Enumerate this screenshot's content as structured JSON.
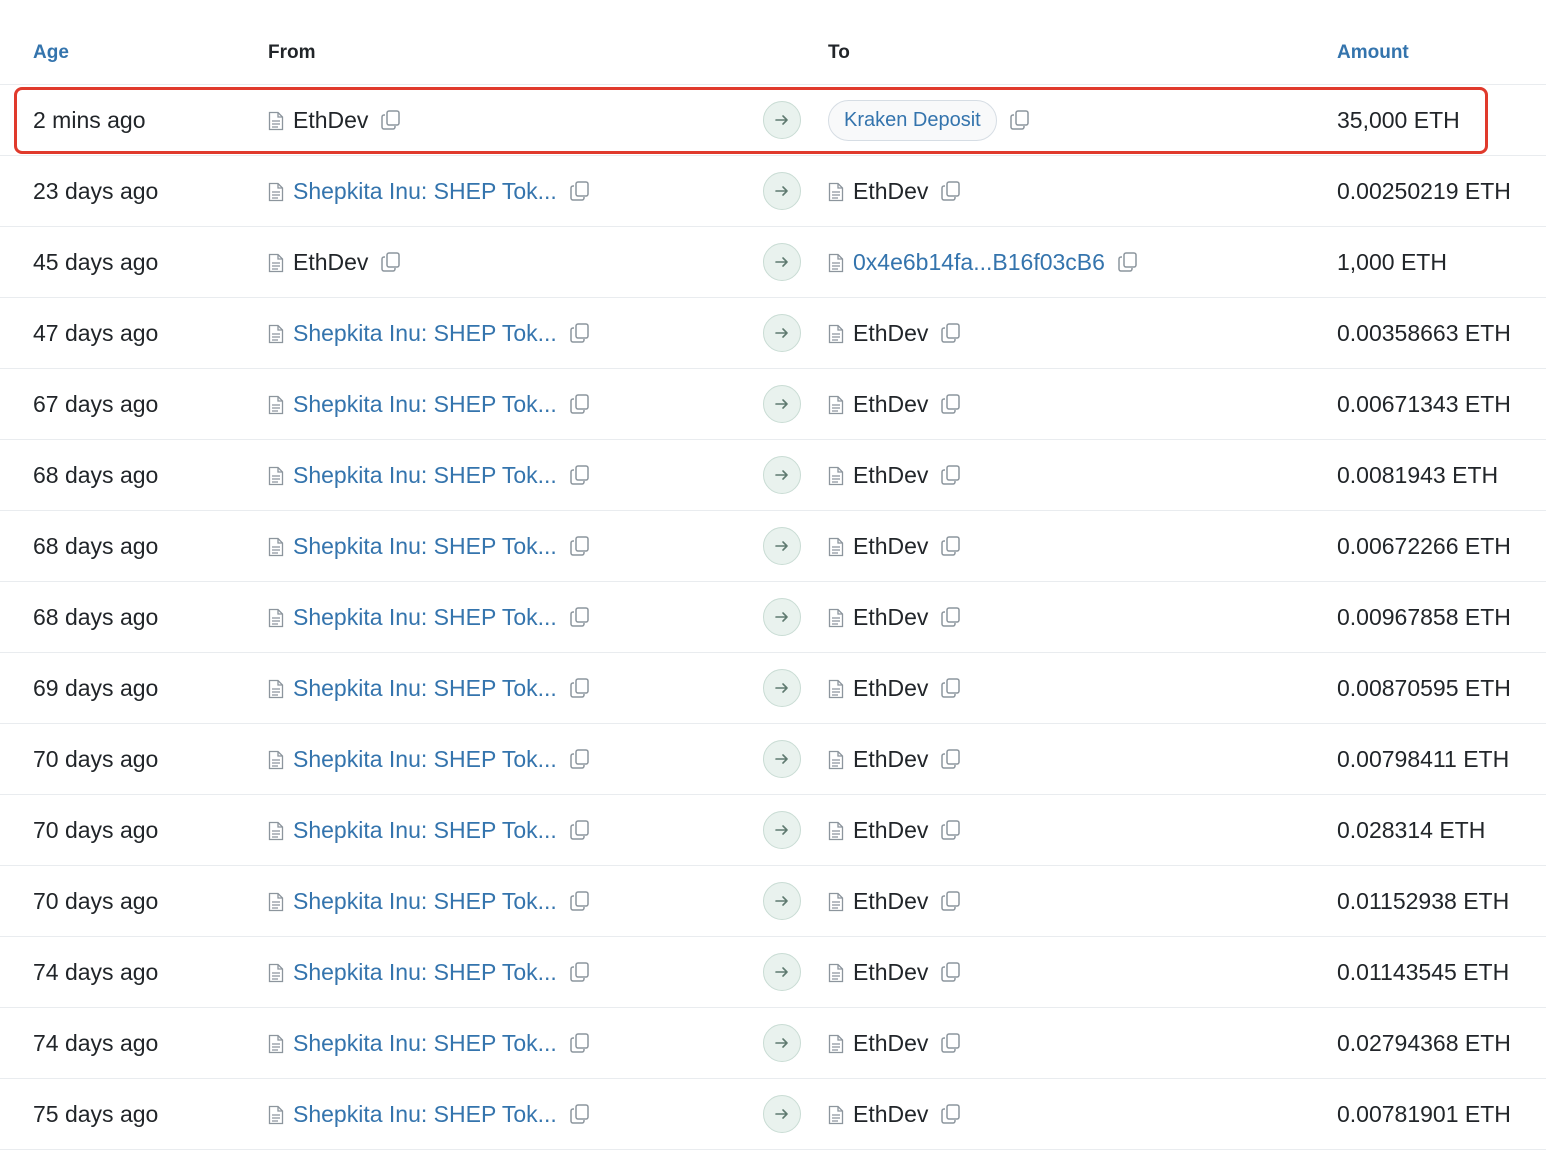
{
  "headers": {
    "age": "Age",
    "from": "From",
    "to": "To",
    "amount": "Amount"
  },
  "highlight_color": "#e03a2c",
  "link_color": "#3474ad",
  "icons": {
    "address": "document-icon",
    "copy": "copy-icon",
    "direction": "arrow-right-icon"
  },
  "rows": [
    {
      "age": "2 mins ago",
      "from": {
        "label": "EthDev",
        "link": false
      },
      "to": {
        "label": "Kraken Deposit",
        "tag": true
      },
      "amount": "35,000 ETH"
    },
    {
      "age": "23 days ago",
      "from": {
        "label": "Shepkita Inu: SHEP Tok...",
        "link": true
      },
      "to": {
        "label": "EthDev",
        "link": false
      },
      "amount": "0.00250219 ETH"
    },
    {
      "age": "45 days ago",
      "from": {
        "label": "EthDev",
        "link": false
      },
      "to": {
        "label": "0x4e6b14fa...B16f03cB6",
        "link": true
      },
      "amount": "1,000 ETH"
    },
    {
      "age": "47 days ago",
      "from": {
        "label": "Shepkita Inu: SHEP Tok...",
        "link": true
      },
      "to": {
        "label": "EthDev",
        "link": false
      },
      "amount": "0.00358663 ETH"
    },
    {
      "age": "67 days ago",
      "from": {
        "label": "Shepkita Inu: SHEP Tok...",
        "link": true
      },
      "to": {
        "label": "EthDev",
        "link": false
      },
      "amount": "0.00671343 ETH"
    },
    {
      "age": "68 days ago",
      "from": {
        "label": "Shepkita Inu: SHEP Tok...",
        "link": true
      },
      "to": {
        "label": "EthDev",
        "link": false
      },
      "amount": "0.0081943 ETH"
    },
    {
      "age": "68 days ago",
      "from": {
        "label": "Shepkita Inu: SHEP Tok...",
        "link": true
      },
      "to": {
        "label": "EthDev",
        "link": false
      },
      "amount": "0.00672266 ETH"
    },
    {
      "age": "68 days ago",
      "from": {
        "label": "Shepkita Inu: SHEP Tok...",
        "link": true
      },
      "to": {
        "label": "EthDev",
        "link": false
      },
      "amount": "0.00967858 ETH"
    },
    {
      "age": "69 days ago",
      "from": {
        "label": "Shepkita Inu: SHEP Tok...",
        "link": true
      },
      "to": {
        "label": "EthDev",
        "link": false
      },
      "amount": "0.00870595 ETH"
    },
    {
      "age": "70 days ago",
      "from": {
        "label": "Shepkita Inu: SHEP Tok...",
        "link": true
      },
      "to": {
        "label": "EthDev",
        "link": false
      },
      "amount": "0.00798411 ETH"
    },
    {
      "age": "70 days ago",
      "from": {
        "label": "Shepkita Inu: SHEP Tok...",
        "link": true
      },
      "to": {
        "label": "EthDev",
        "link": false
      },
      "amount": "0.028314 ETH"
    },
    {
      "age": "70 days ago",
      "from": {
        "label": "Shepkita Inu: SHEP Tok...",
        "link": true
      },
      "to": {
        "label": "EthDev",
        "link": false
      },
      "amount": "0.01152938 ETH"
    },
    {
      "age": "74 days ago",
      "from": {
        "label": "Shepkita Inu: SHEP Tok...",
        "link": true
      },
      "to": {
        "label": "EthDev",
        "link": false
      },
      "amount": "0.01143545 ETH"
    },
    {
      "age": "74 days ago",
      "from": {
        "label": "Shepkita Inu: SHEP Tok...",
        "link": true
      },
      "to": {
        "label": "EthDev",
        "link": false
      },
      "amount": "0.02794368 ETH"
    },
    {
      "age": "75 days ago",
      "from": {
        "label": "Shepkita Inu: SHEP Tok...",
        "link": true
      },
      "to": {
        "label": "EthDev",
        "link": false
      },
      "amount": "0.00781901 ETH"
    }
  ]
}
